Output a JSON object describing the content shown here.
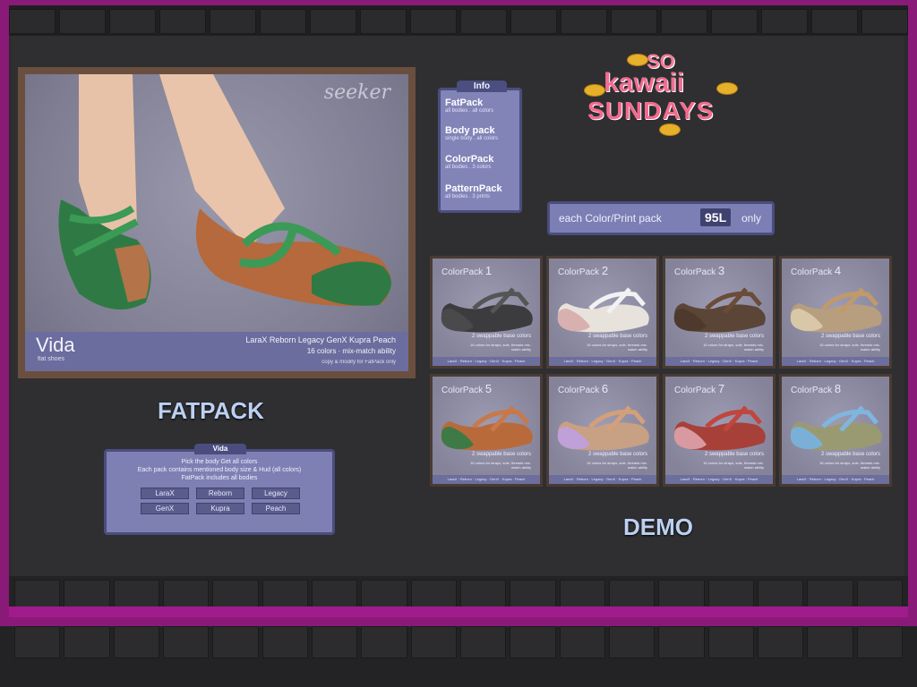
{
  "main_picture": {
    "brand": "seeker",
    "title": "Vida",
    "subtitle": "flat shoes",
    "bodies_line": "LaraX  Reborn  Legacy  GenX  Kupra  Peach",
    "colors_line": "16 colors · mix-match ability",
    "copy_line": "copy & modify for FatPack only"
  },
  "headings": {
    "fatpack": "FATPACK",
    "demo": "DEMO"
  },
  "info_panel": {
    "tab": "Info",
    "items": [
      {
        "title": "FatPack",
        "sub": "all bodies . all colors"
      },
      {
        "title": "Body pack",
        "sub": "single body . all colors"
      },
      {
        "title": "ColorPack",
        "sub": "all bodies . 3 colors"
      },
      {
        "title": "PatternPack",
        "sub": "all bodies . 3 prints"
      }
    ]
  },
  "price": {
    "pre": "each Color/Print pack",
    "amount": "95L",
    "post": "only"
  },
  "logo": {
    "so": "SO",
    "kawaii": "kawaii",
    "sundays": "SUNDAYS"
  },
  "vida_panel": {
    "tab": "Vida",
    "line1": "Pick the body Get all colors",
    "line2": "Each pack contains mentioned body size & Hud (all colors)",
    "line3": "FatPack includes all bodies",
    "buttons": [
      "LaraX",
      "Reborn",
      "Legacy",
      "GenX",
      "Kupra",
      "Peach"
    ]
  },
  "packs": [
    {
      "label": "ColorPack",
      "num": "1",
      "upper": "#3c3c3e",
      "lower": "#4a4a4c",
      "strap": "#555"
    },
    {
      "label": "ColorPack",
      "num": "2",
      "upper": "#e8e2dc",
      "lower": "#d9b0b0",
      "strap": "#f2f2f2"
    },
    {
      "label": "ColorPack",
      "num": "3",
      "upper": "#5b4536",
      "lower": "#4e3a2d",
      "strap": "#6a4c38"
    },
    {
      "label": "ColorPack",
      "num": "4",
      "upper": "#b79e7e",
      "lower": "#d8c8a8",
      "strap": "#c09a6a"
    },
    {
      "label": "ColorPack",
      "num": "5",
      "upper": "#b96a3b",
      "lower": "#3e7a45",
      "strap": "#c8784a"
    },
    {
      "label": "ColorPack",
      "num": "6",
      "upper": "#c8a084",
      "lower": "#c0a0d8",
      "strap": "#d4a07a"
    },
    {
      "label": "ColorPack",
      "num": "7",
      "upper": "#a8403a",
      "lower": "#d89aa0",
      "strap": "#c0463e"
    },
    {
      "label": "ColorPack",
      "num": "8",
      "upper": "#9a9a72",
      "lower": "#7ab0d8",
      "strap": "#7fb6e0"
    }
  ],
  "pack_common": {
    "note1": "2 swappable base colors",
    "note2": "16 colors for straps, sole, threads mix-match ability",
    "foot": "LaraX · Reborn · Legacy · GenX · Kupra · Peach"
  }
}
